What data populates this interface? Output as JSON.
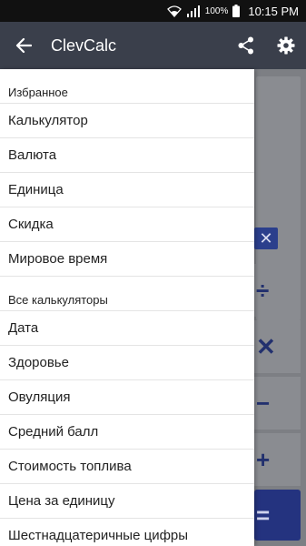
{
  "status_bar": {
    "battery_percent": "100%",
    "time": "10:15 PM"
  },
  "app_bar": {
    "title": "ClevCalc",
    "back_icon": "arrow-back-icon",
    "share_icon": "share-icon",
    "settings_icon": "gear-icon"
  },
  "drawer": {
    "favorites_header": "Избранное",
    "favorites": [
      {
        "label": "Калькулятор"
      },
      {
        "label": "Валюта"
      },
      {
        "label": "Единица"
      },
      {
        "label": "Скидка"
      },
      {
        "label": "Мировое время"
      }
    ],
    "all_header": "Все калькуляторы",
    "all": [
      {
        "label": "Дата"
      },
      {
        "label": "Здоровье"
      },
      {
        "label": "Овуляция"
      },
      {
        "label": "Средний балл"
      },
      {
        "label": "Стоимость топлива"
      },
      {
        "label": "Цена за единицу"
      },
      {
        "label": "Шестнадцатеричные цифры"
      }
    ]
  },
  "background": {
    "clear_key": "✕",
    "keys": [
      {
        "symbol": "÷"
      },
      {
        "symbol": "✕"
      },
      {
        "symbol": "−"
      },
      {
        "symbol": "+"
      },
      {
        "symbol": "="
      }
    ]
  },
  "colors": {
    "app_bar": "#3a3f4b",
    "accent": "#24337f",
    "status_bar": "#111111"
  }
}
